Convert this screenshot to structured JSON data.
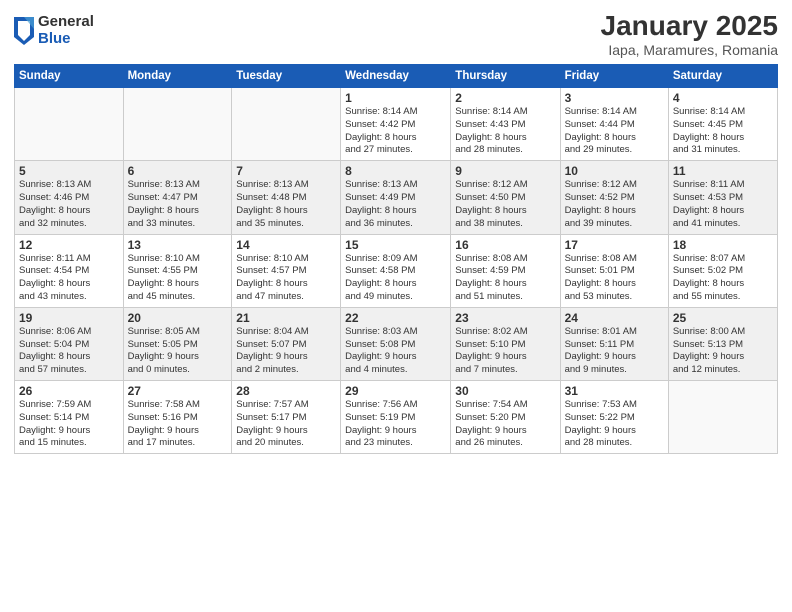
{
  "logo": {
    "general": "General",
    "blue": "Blue"
  },
  "header": {
    "title": "January 2025",
    "location": "Iapa, Maramures, Romania"
  },
  "weekdays": [
    "Sunday",
    "Monday",
    "Tuesday",
    "Wednesday",
    "Thursday",
    "Friday",
    "Saturday"
  ],
  "weeks": [
    [
      {
        "day": "",
        "info": ""
      },
      {
        "day": "",
        "info": ""
      },
      {
        "day": "",
        "info": ""
      },
      {
        "day": "1",
        "info": "Sunrise: 8:14 AM\nSunset: 4:42 PM\nDaylight: 8 hours\nand 27 minutes."
      },
      {
        "day": "2",
        "info": "Sunrise: 8:14 AM\nSunset: 4:43 PM\nDaylight: 8 hours\nand 28 minutes."
      },
      {
        "day": "3",
        "info": "Sunrise: 8:14 AM\nSunset: 4:44 PM\nDaylight: 8 hours\nand 29 minutes."
      },
      {
        "day": "4",
        "info": "Sunrise: 8:14 AM\nSunset: 4:45 PM\nDaylight: 8 hours\nand 31 minutes."
      }
    ],
    [
      {
        "day": "5",
        "info": "Sunrise: 8:13 AM\nSunset: 4:46 PM\nDaylight: 8 hours\nand 32 minutes."
      },
      {
        "day": "6",
        "info": "Sunrise: 8:13 AM\nSunset: 4:47 PM\nDaylight: 8 hours\nand 33 minutes."
      },
      {
        "day": "7",
        "info": "Sunrise: 8:13 AM\nSunset: 4:48 PM\nDaylight: 8 hours\nand 35 minutes."
      },
      {
        "day": "8",
        "info": "Sunrise: 8:13 AM\nSunset: 4:49 PM\nDaylight: 8 hours\nand 36 minutes."
      },
      {
        "day": "9",
        "info": "Sunrise: 8:12 AM\nSunset: 4:50 PM\nDaylight: 8 hours\nand 38 minutes."
      },
      {
        "day": "10",
        "info": "Sunrise: 8:12 AM\nSunset: 4:52 PM\nDaylight: 8 hours\nand 39 minutes."
      },
      {
        "day": "11",
        "info": "Sunrise: 8:11 AM\nSunset: 4:53 PM\nDaylight: 8 hours\nand 41 minutes."
      }
    ],
    [
      {
        "day": "12",
        "info": "Sunrise: 8:11 AM\nSunset: 4:54 PM\nDaylight: 8 hours\nand 43 minutes."
      },
      {
        "day": "13",
        "info": "Sunrise: 8:10 AM\nSunset: 4:55 PM\nDaylight: 8 hours\nand 45 minutes."
      },
      {
        "day": "14",
        "info": "Sunrise: 8:10 AM\nSunset: 4:57 PM\nDaylight: 8 hours\nand 47 minutes."
      },
      {
        "day": "15",
        "info": "Sunrise: 8:09 AM\nSunset: 4:58 PM\nDaylight: 8 hours\nand 49 minutes."
      },
      {
        "day": "16",
        "info": "Sunrise: 8:08 AM\nSunset: 4:59 PM\nDaylight: 8 hours\nand 51 minutes."
      },
      {
        "day": "17",
        "info": "Sunrise: 8:08 AM\nSunset: 5:01 PM\nDaylight: 8 hours\nand 53 minutes."
      },
      {
        "day": "18",
        "info": "Sunrise: 8:07 AM\nSunset: 5:02 PM\nDaylight: 8 hours\nand 55 minutes."
      }
    ],
    [
      {
        "day": "19",
        "info": "Sunrise: 8:06 AM\nSunset: 5:04 PM\nDaylight: 8 hours\nand 57 minutes."
      },
      {
        "day": "20",
        "info": "Sunrise: 8:05 AM\nSunset: 5:05 PM\nDaylight: 9 hours\nand 0 minutes."
      },
      {
        "day": "21",
        "info": "Sunrise: 8:04 AM\nSunset: 5:07 PM\nDaylight: 9 hours\nand 2 minutes."
      },
      {
        "day": "22",
        "info": "Sunrise: 8:03 AM\nSunset: 5:08 PM\nDaylight: 9 hours\nand 4 minutes."
      },
      {
        "day": "23",
        "info": "Sunrise: 8:02 AM\nSunset: 5:10 PM\nDaylight: 9 hours\nand 7 minutes."
      },
      {
        "day": "24",
        "info": "Sunrise: 8:01 AM\nSunset: 5:11 PM\nDaylight: 9 hours\nand 9 minutes."
      },
      {
        "day": "25",
        "info": "Sunrise: 8:00 AM\nSunset: 5:13 PM\nDaylight: 9 hours\nand 12 minutes."
      }
    ],
    [
      {
        "day": "26",
        "info": "Sunrise: 7:59 AM\nSunset: 5:14 PM\nDaylight: 9 hours\nand 15 minutes."
      },
      {
        "day": "27",
        "info": "Sunrise: 7:58 AM\nSunset: 5:16 PM\nDaylight: 9 hours\nand 17 minutes."
      },
      {
        "day": "28",
        "info": "Sunrise: 7:57 AM\nSunset: 5:17 PM\nDaylight: 9 hours\nand 20 minutes."
      },
      {
        "day": "29",
        "info": "Sunrise: 7:56 AM\nSunset: 5:19 PM\nDaylight: 9 hours\nand 23 minutes."
      },
      {
        "day": "30",
        "info": "Sunrise: 7:54 AM\nSunset: 5:20 PM\nDaylight: 9 hours\nand 26 minutes."
      },
      {
        "day": "31",
        "info": "Sunrise: 7:53 AM\nSunset: 5:22 PM\nDaylight: 9 hours\nand 28 minutes."
      },
      {
        "day": "",
        "info": ""
      }
    ]
  ]
}
